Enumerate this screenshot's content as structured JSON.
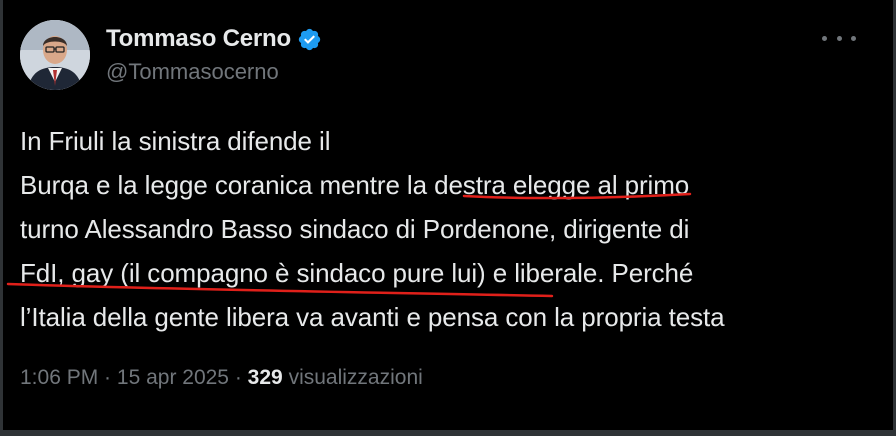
{
  "author": {
    "display_name": "Tommaso Cerno",
    "handle": "@Tommasocerno",
    "verified": true
  },
  "tweet": {
    "lines": [
      "In Friuli la sinistra difende il",
      "Burqa e la legge coranica mentre la destra elegge al primo",
      "turno Alessandro Basso sindaco di Pordenone, dirigente di",
      "FdI, gay (il compagno è sindaco pure lui) e liberale. Perché",
      "l’Italia della gente libera va avanti e pensa con la propria testa"
    ]
  },
  "meta": {
    "time": "1:06 PM",
    "separator": " · ",
    "date": "15 apr 2025",
    "views_count": "329",
    "views_label": "visualizzazioni"
  },
  "icons": {
    "verified": "verified-badge-icon",
    "more": "more-options-icon"
  },
  "colors": {
    "background": "#000000",
    "text": "#e7e9ea",
    "secondary": "#71767b",
    "verified": "#1d9bf0",
    "annotation": "#e0201a"
  }
}
